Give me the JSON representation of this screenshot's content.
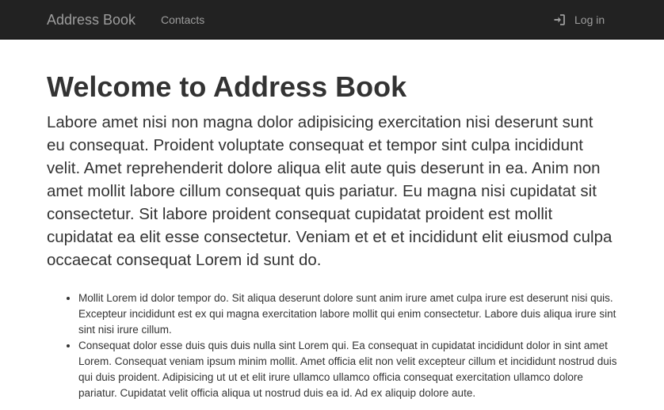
{
  "navbar": {
    "brand": "Address Book",
    "links": [
      {
        "label": "Contacts"
      }
    ],
    "login": {
      "label": "Log in",
      "icon": "log-in-icon"
    }
  },
  "main": {
    "title": "Welcome to Address Book",
    "lead": "Labore amet nisi non magna dolor adipisicing exercitation nisi deserunt sunt eu consequat. Proident voluptate consequat et tempor sint culpa incididunt velit. Amet reprehenderit dolore aliqua elit aute quis deserunt in ea. Anim non amet mollit labore cillum consequat quis pariatur. Eu magna nisi cupidatat sit consectetur. Sit labore proident consequat cupidatat proident est mollit cupidatat ea elit esse consectetur. Veniam et et et incididunt elit eiusmod culpa occaecat consequat Lorem id sunt do.",
    "items": [
      "Mollit Lorem id dolor tempor do. Sit aliqua deserunt dolore sunt anim irure amet culpa irure est deserunt nisi quis. Excepteur incididunt est ex qui magna exercitation labore mollit qui enim consectetur. Labore duis aliqua irure sint sint nisi irure cillum.",
      "Consequat dolor esse duis quis duis nulla sint Lorem qui. Ea consequat in cupidatat incididunt dolor in sint amet Lorem. Consequat veniam ipsum minim mollit. Amet officia elit non velit excepteur cillum et incididunt nostrud duis qui duis proident. Adipisicing ut ut et elit irure ullamco ullamco officia consequat exercitation ullamco dolore pariatur. Cupidatat velit officia aliqua ut nostrud duis ea id. Ad ex aliquip dolore aute."
    ]
  },
  "colors": {
    "navbar_bg": "#222222",
    "navbar_text": "#9d9d9d",
    "body_text": "#333333",
    "page_bg": "#ffffff"
  }
}
